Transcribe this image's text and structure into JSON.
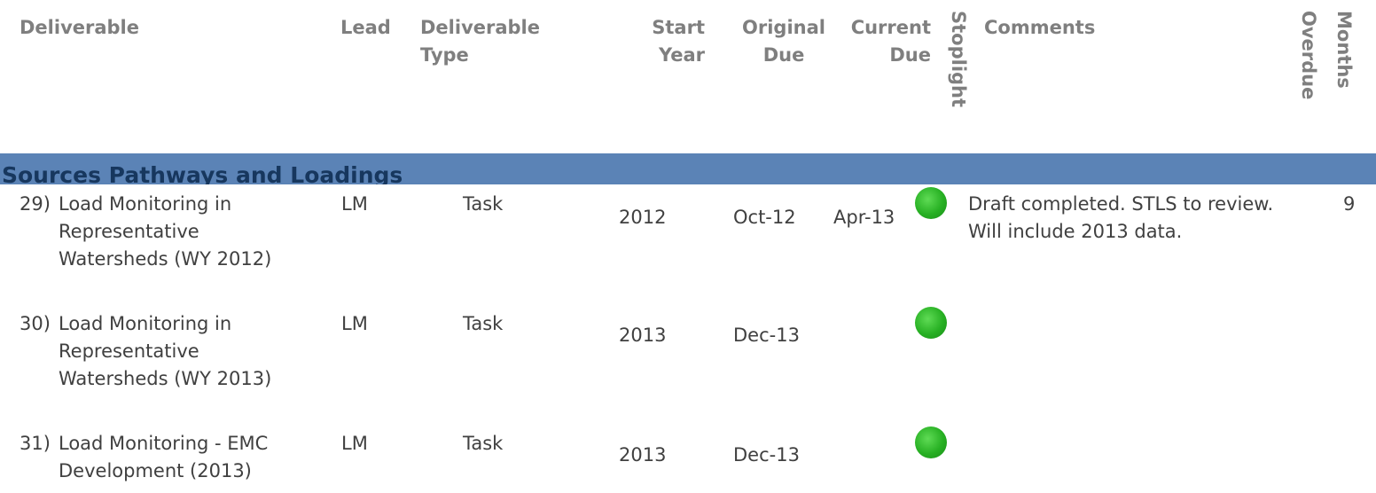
{
  "headers": {
    "deliverable": "Deliverable",
    "lead": "Lead",
    "type_line1": "Deliverable",
    "type_line2": "Type",
    "start_line1": "Start",
    "start_line2": "Year",
    "orig_line1": "Original",
    "orig_line2": "Due",
    "curr_line1": "Current",
    "curr_line2": "Due",
    "stoplight": "Stoplight",
    "comments": "Comments",
    "months": "Months",
    "overdue": "Overdue"
  },
  "section": {
    "title": "Sources Pathways and Loadings"
  },
  "status_color": "#27b023",
  "rows": [
    {
      "num": "29)",
      "deliverable": "Load Monitoring in Representative Watersheds (WY 2012)",
      "lead": "LM",
      "type": "Task",
      "start_year": "2012",
      "original_due": "Oct-12",
      "current_due": "Apr-13",
      "stoplight": "green",
      "comments": "Draft completed. STLS to review. Will include 2013 data.",
      "months_overdue": "9"
    },
    {
      "num": "30)",
      "deliverable": "Load Monitoring in Representative Watersheds (WY 2013)",
      "lead": "LM",
      "type": "Task",
      "start_year": "2013",
      "original_due": "Dec-13",
      "current_due": "",
      "stoplight": "green",
      "comments": "",
      "months_overdue": ""
    },
    {
      "num": "31)",
      "deliverable": "Load Monitoring - EMC Development (2013)",
      "lead": "LM",
      "type": "Task",
      "start_year": "2013",
      "original_due": "Dec-13",
      "current_due": "",
      "stoplight": "green",
      "comments": "",
      "months_overdue": ""
    }
  ]
}
